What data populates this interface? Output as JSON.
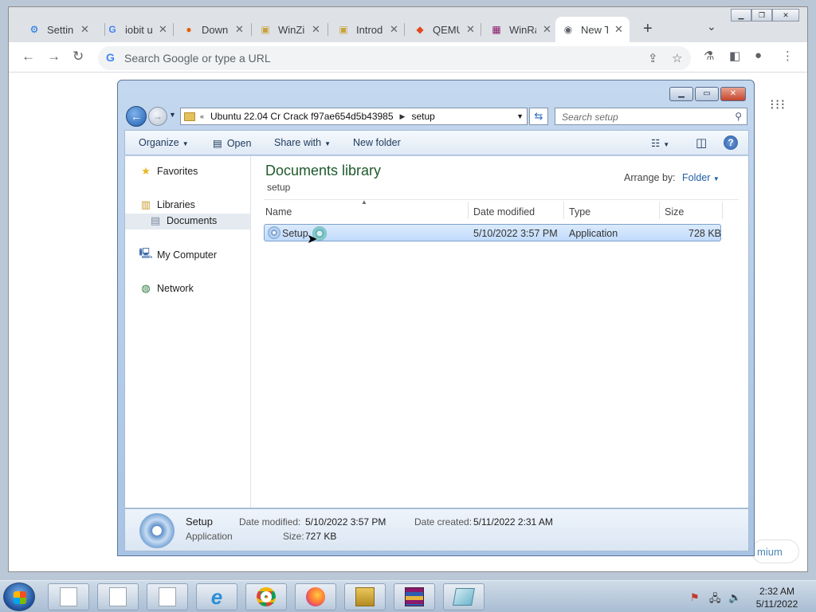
{
  "browser": {
    "tabs": [
      {
        "title": "Settin",
        "icon": "gear-icon",
        "color": "#1a73e8"
      },
      {
        "title": "iobit u",
        "icon": "google-icon",
        "color": "#4285f4"
      },
      {
        "title": "Down",
        "icon": "firefox-icon",
        "color": "#e66000"
      },
      {
        "title": "WinZi",
        "icon": "winzip-icon",
        "color": "#c9a23a"
      },
      {
        "title": "Introd",
        "icon": "winzip-icon",
        "color": "#c9a23a"
      },
      {
        "title": "QEMU",
        "icon": "qemu-icon",
        "color": "#e04a1f"
      },
      {
        "title": "WinRa",
        "icon": "winrar-icon",
        "color": "#8b1a6b"
      },
      {
        "title": "New T",
        "icon": "chrome-icon",
        "color": "#5f6368"
      }
    ],
    "omnibox_placeholder": "Search Google or type a URL",
    "premium_label": "mium"
  },
  "explorer": {
    "breadcrumb": [
      "Ubuntu 22.04 Cr Crack f97ae654d5b43985",
      "setup"
    ],
    "search_placeholder": "Search setup",
    "commands": {
      "organize": "Organize",
      "open": "Open",
      "share_with": "Share with",
      "new_folder": "New folder"
    },
    "nav": {
      "favorites": "Favorites",
      "libraries": "Libraries",
      "documents": "Documents",
      "my_computer": "My Computer",
      "network": "Network"
    },
    "library_title": "Documents library",
    "library_sub": "setup",
    "arrange_label": "Arrange by:",
    "arrange_value": "Folder",
    "columns": {
      "name": "Name",
      "date": "Date modified",
      "type": "Type",
      "size": "Size"
    },
    "file": {
      "name": "Setup",
      "date": "5/10/2022 3:57 PM",
      "type": "Application",
      "size": "728 KB"
    },
    "details": {
      "name": "Setup",
      "kind": "Application",
      "date_modified_label": "Date modified:",
      "date_modified": "5/10/2022 3:57 PM",
      "size_label": "Size:",
      "size": "727 KB",
      "date_created_label": "Date created:",
      "date_created": "5/11/2022 2:31 AM"
    }
  },
  "taskbar": {
    "time": "2:32 AM",
    "date": "5/11/2022"
  }
}
